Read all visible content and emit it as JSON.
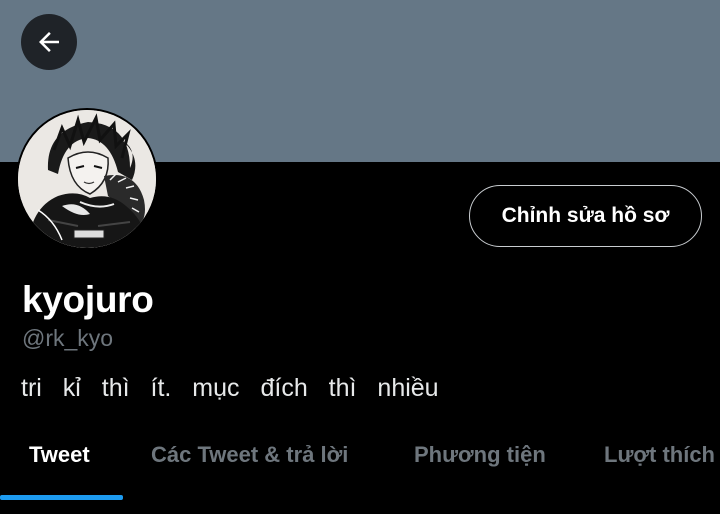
{
  "profile": {
    "display_name": "kyojuro",
    "handle": "@rk_kyo",
    "bio": "tri kỉ thì ít. mục đích thì nhiều",
    "edit_profile_label": "Chỉnh sửa hồ sơ"
  },
  "tabs": [
    {
      "label": "Tweet",
      "active": true
    },
    {
      "label": "Các Tweet & trả lời",
      "active": false
    },
    {
      "label": "Phương tiện",
      "active": false
    },
    {
      "label": "Lượt thích",
      "active": false
    }
  ],
  "colors": {
    "banner": "#657786",
    "background": "#000000",
    "accent": "#1d9bf0",
    "secondary_text": "#6e767d"
  },
  "icons": {
    "back": "arrow-left-icon"
  }
}
